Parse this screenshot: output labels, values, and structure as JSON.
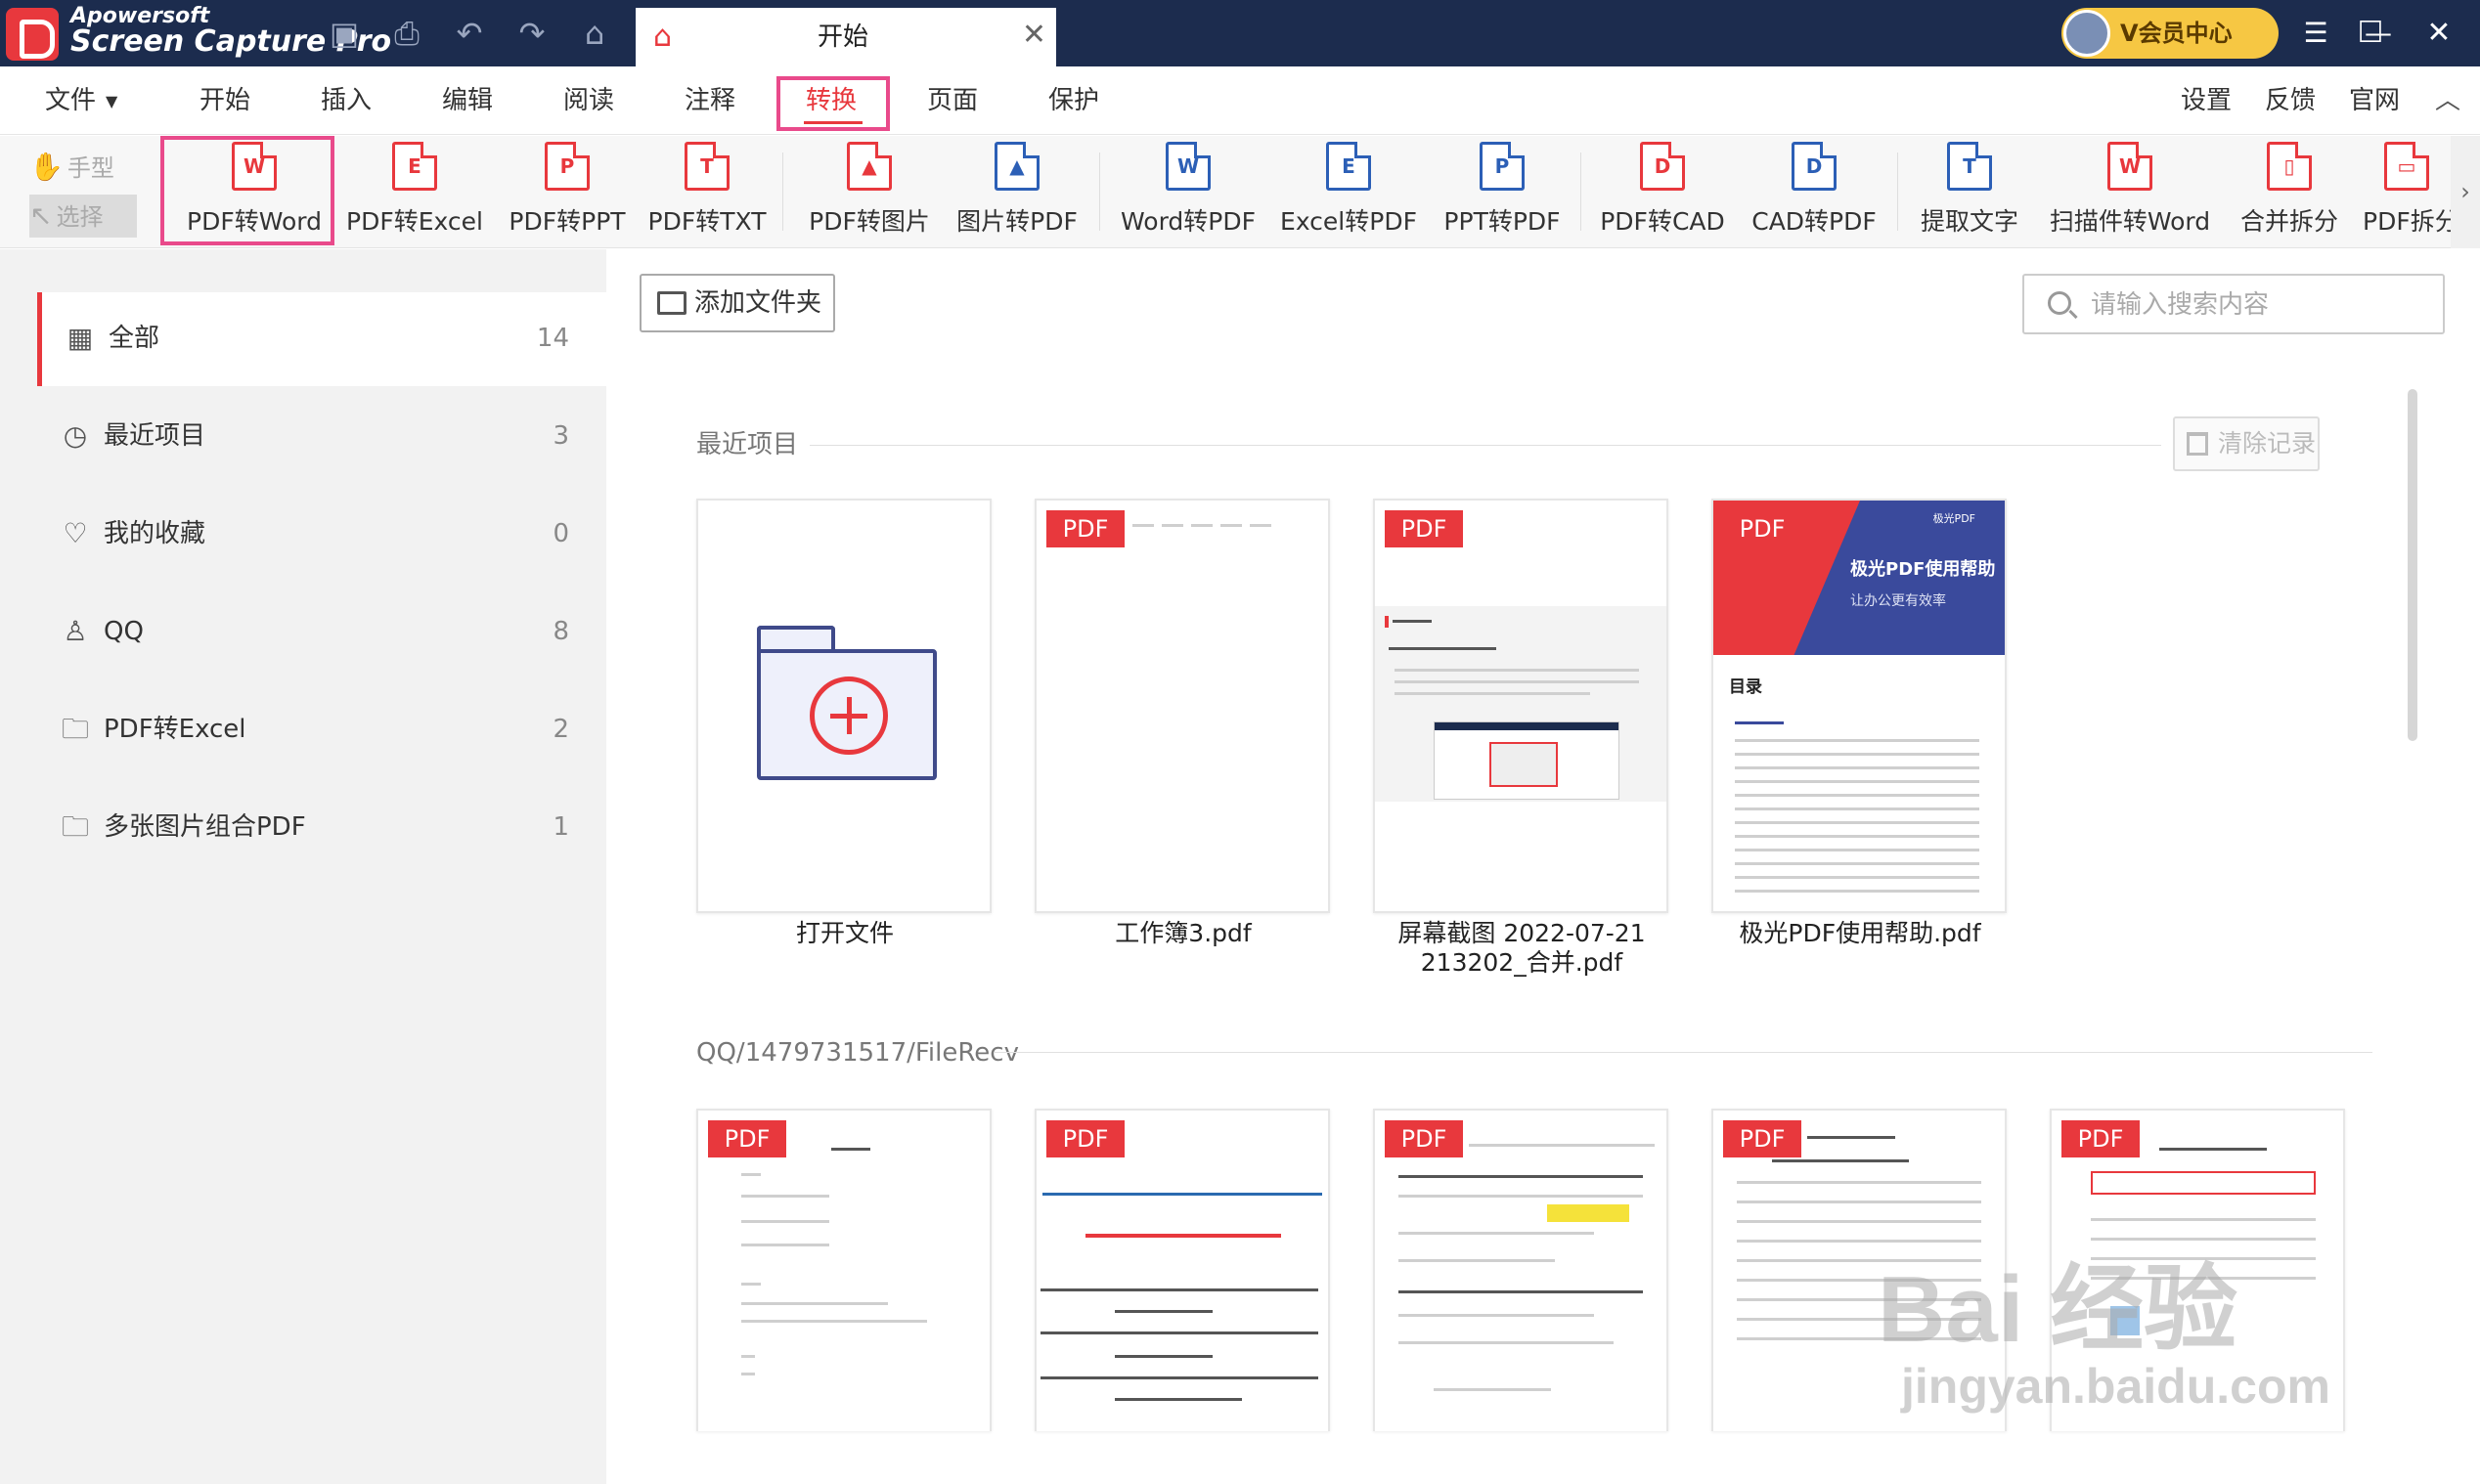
{
  "titlebar": {
    "watermark_line1": "Apowersoft",
    "watermark_line2": "Screen Capture Pro",
    "tab_title": "开始",
    "vip_label": "V会员中心",
    "icons": {
      "save": "save-icon",
      "print": "print-icon",
      "undo": "undo-icon",
      "redo": "redo-icon",
      "home": "home-icon",
      "close": "close-icon",
      "minimize": "minimize-icon",
      "maximize": "maximize-icon"
    }
  },
  "menu": {
    "file": "文件",
    "start": "开始",
    "insert": "插入",
    "edit": "编辑",
    "read": "阅读",
    "annotate": "注释",
    "convert": "转换",
    "page": "页面",
    "protect": "保护",
    "settings": "设置",
    "feedback": "反馈",
    "website": "官网"
  },
  "toolbar": {
    "hand_mode": "手型",
    "select_mode": "选择",
    "tools": [
      {
        "label": "PDF转Word",
        "glyph": "W"
      },
      {
        "label": "PDF转Excel",
        "glyph": "E"
      },
      {
        "label": "PDF转PPT",
        "glyph": "P"
      },
      {
        "label": "PDF转TXT",
        "glyph": "T"
      },
      {
        "label": "PDF转图片",
        "glyph": "▲"
      },
      {
        "label": "图片转PDF",
        "glyph": "▲"
      },
      {
        "label": "Word转PDF",
        "glyph": "W"
      },
      {
        "label": "Excel转PDF",
        "glyph": "E"
      },
      {
        "label": "PPT转PDF",
        "glyph": "P"
      },
      {
        "label": "PDF转CAD",
        "glyph": "D"
      },
      {
        "label": "CAD转PDF",
        "glyph": "D"
      },
      {
        "label": "提取文字",
        "glyph": "T"
      },
      {
        "label": "扫描件转Word",
        "glyph": "W"
      },
      {
        "label": "合并拆分",
        "glyph": "▯"
      },
      {
        "label": "PDF拆分",
        "glyph": "▭"
      }
    ]
  },
  "sidebar": {
    "items": [
      {
        "label": "全部",
        "count": "14",
        "icon": "grid-icon"
      },
      {
        "label": "最近项目",
        "count": "3",
        "icon": "clock-icon"
      },
      {
        "label": "我的收藏",
        "count": "0",
        "icon": "heart-icon"
      },
      {
        "label": "QQ",
        "count": "8",
        "icon": "qq-icon"
      },
      {
        "label": "PDF转Excel",
        "count": "2",
        "icon": "folder-clock-icon"
      },
      {
        "label": "多张图片组合PDF",
        "count": "1",
        "icon": "folder-clock-icon"
      }
    ]
  },
  "main": {
    "add_folder": "添加文件夹",
    "search_placeholder": "请输入搜索内容",
    "recent_title": "最近项目",
    "clear_records": "清除记录",
    "pdf_badge": "PDF",
    "recent_files": [
      {
        "name": "打开文件"
      },
      {
        "name": "工作簿3.pdf"
      },
      {
        "name_line1": "屏幕截图 2022-07-21",
        "name_line2": "213202_合并.pdf"
      },
      {
        "name": "极光PDF使用帮助.pdf"
      }
    ],
    "help_cover": {
      "title": "极光PDF使用帮助",
      "subtitle": "让办公更有效率",
      "brand": "极光PDF",
      "toc": "目录"
    },
    "folder_title": "QQ/1479731517/FileRecv"
  },
  "watermark": {
    "brand": "Bai 经验",
    "url": "jingyan.baidu.com"
  }
}
